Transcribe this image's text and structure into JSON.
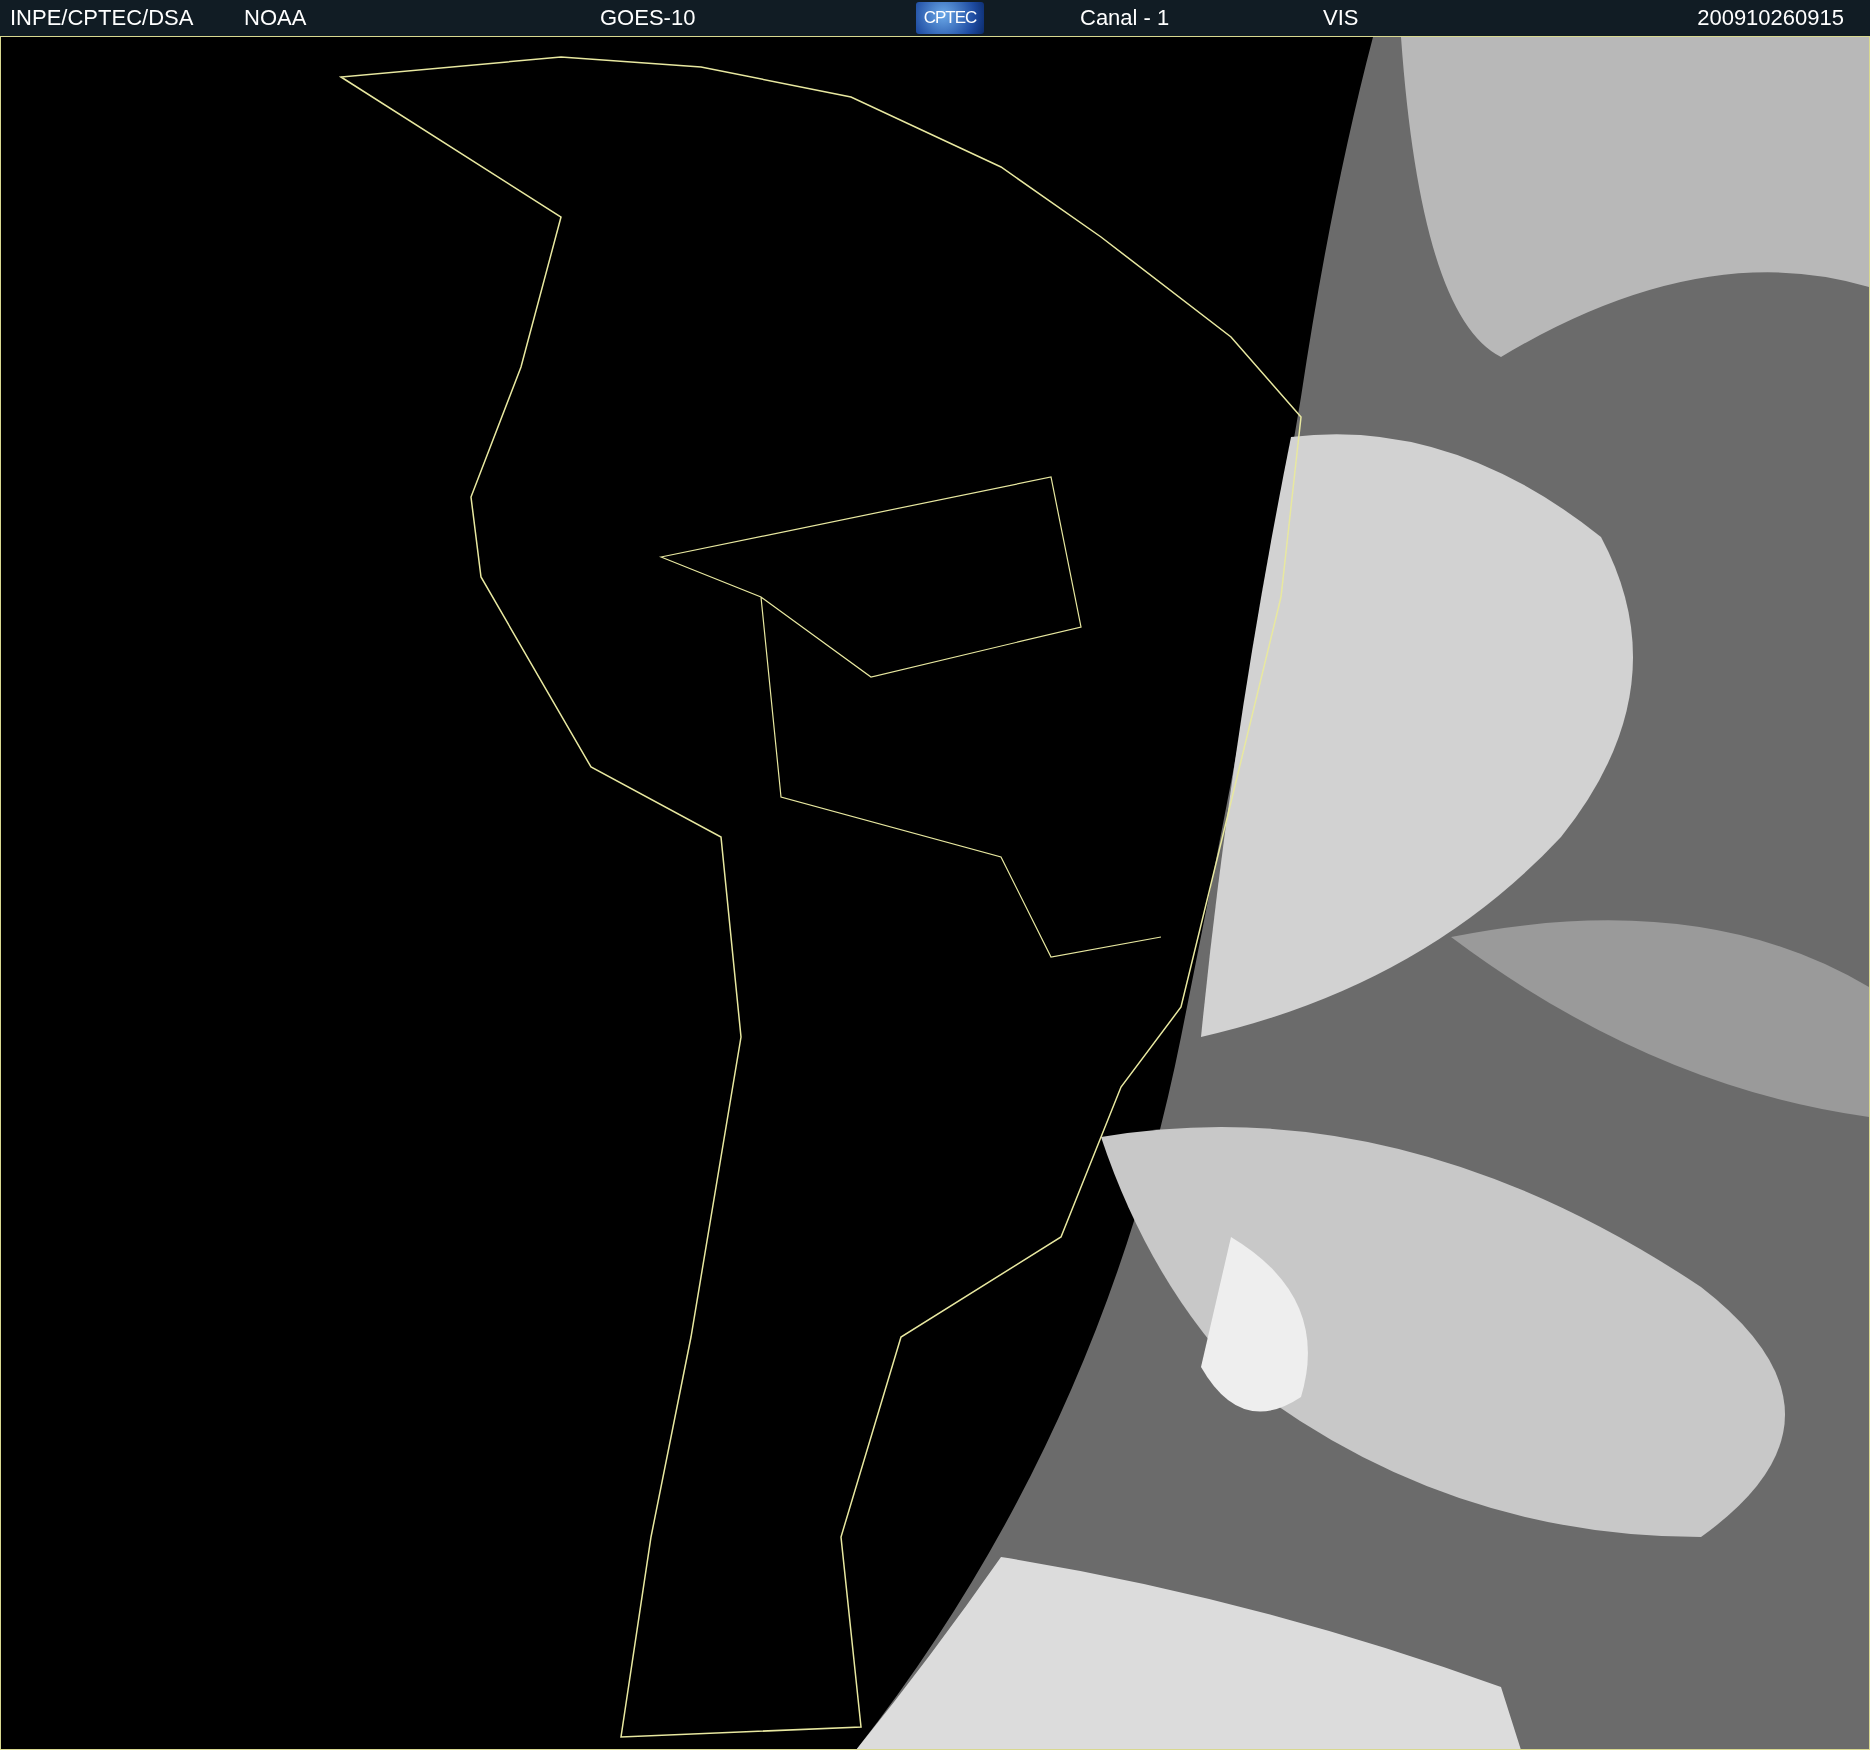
{
  "header": {
    "items": [
      {
        "kind": "text",
        "label": "INPE/CPTEC/DSA"
      },
      {
        "kind": "text",
        "label": "NOAA"
      },
      {
        "kind": "text",
        "label": "GOES-10"
      },
      {
        "kind": "logo",
        "label": "CPTEC"
      },
      {
        "kind": "text",
        "label": "Canal - 1"
      },
      {
        "kind": "text",
        "label": "VIS"
      },
      {
        "kind": "text",
        "label": "200910260915"
      }
    ]
  }
}
